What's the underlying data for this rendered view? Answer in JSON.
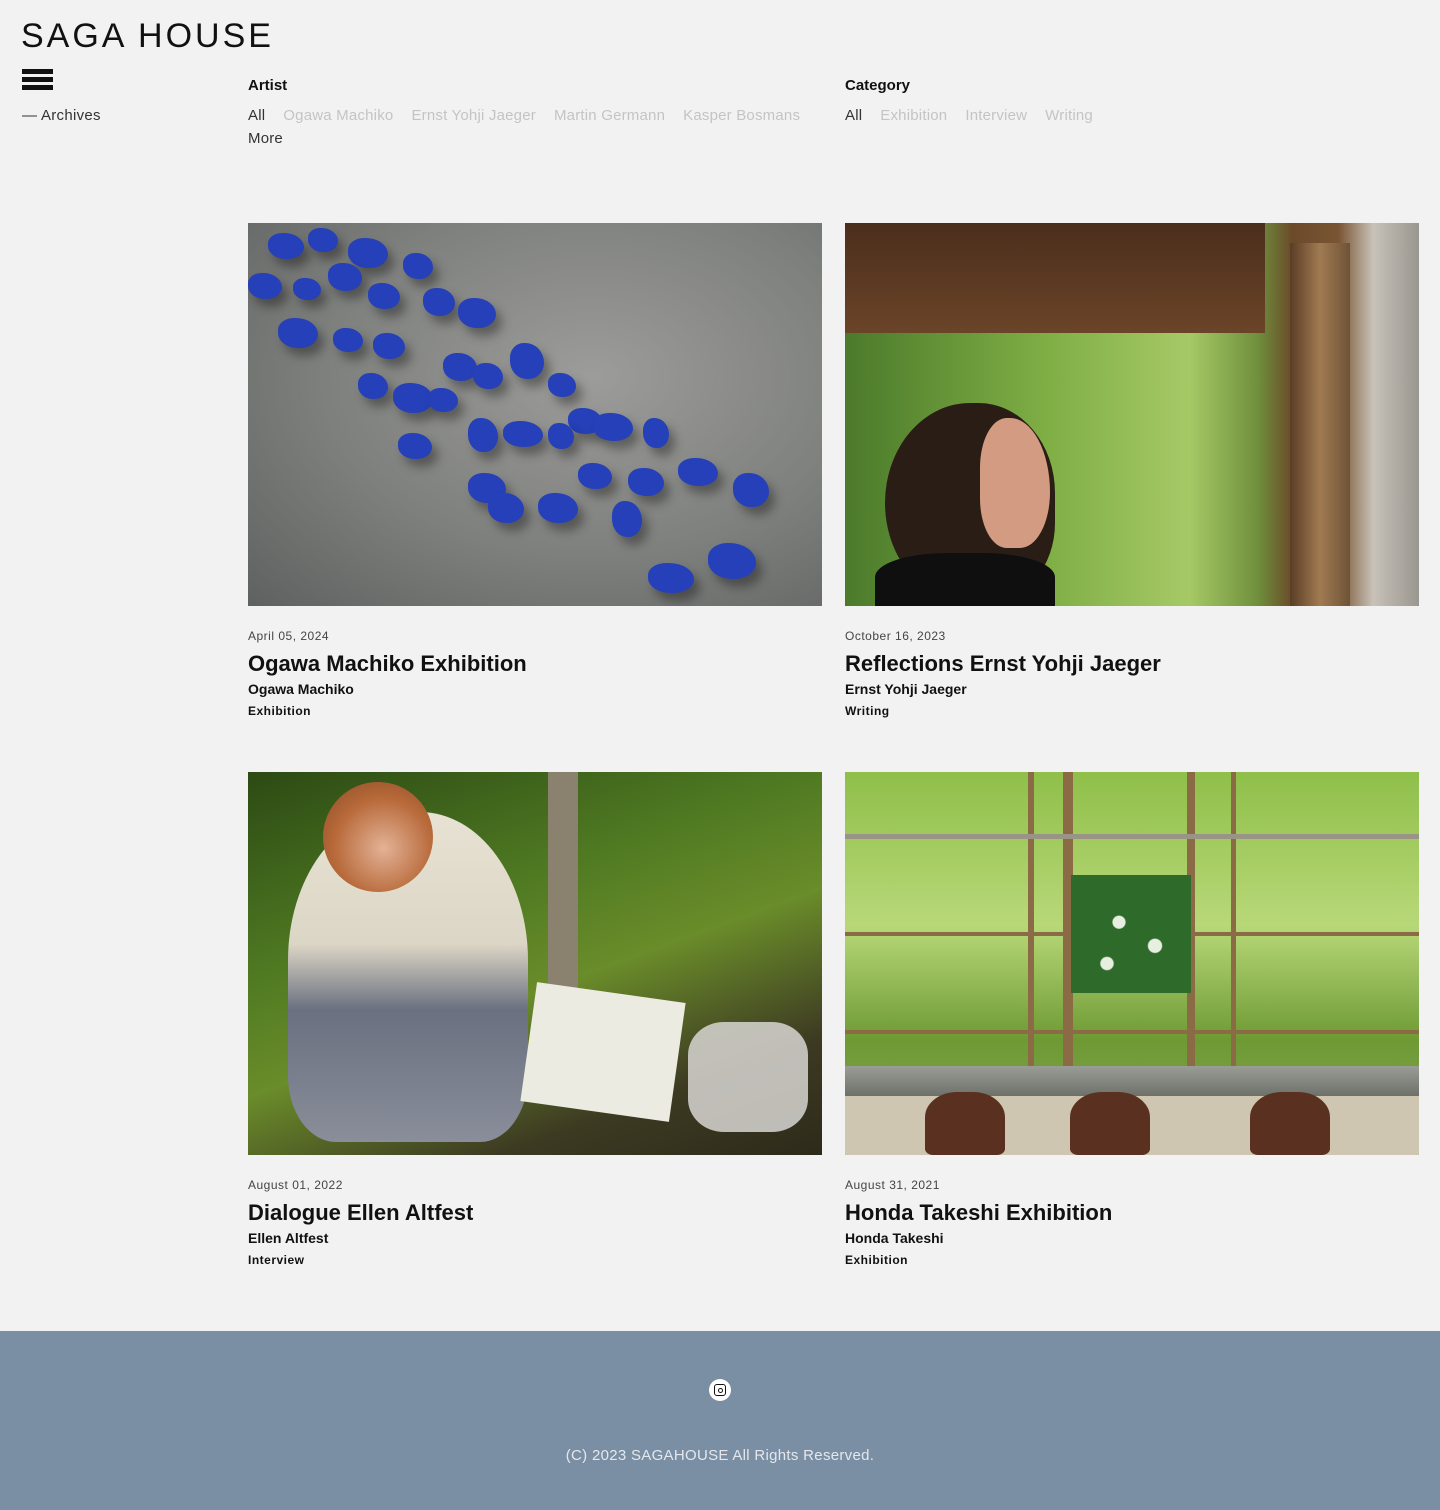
{
  "header": {
    "logo": "SAGA HOUSE",
    "menu_icon": "hamburger-menu-icon",
    "archives_link": "— Archives"
  },
  "filters": {
    "artist": {
      "heading": "Artist",
      "options": [
        "All",
        "Ogawa Machiko",
        "Ernst Yohji Jaeger",
        "Martin Germann",
        "Kasper Bosmans",
        "More"
      ],
      "selected": "All"
    },
    "category": {
      "heading": "Category",
      "options": [
        "All",
        "Exhibition",
        "Interview",
        "Writing"
      ],
      "selected": "All"
    }
  },
  "posts": [
    {
      "date": "April 05, 2024",
      "title": "Ogawa Machiko Exhibition",
      "artist": "Ogawa Machiko",
      "category": "Exhibition"
    },
    {
      "date": "October 16, 2023",
      "title": "Reflections Ernst Yohji Jaeger",
      "artist": "Ernst Yohji Jaeger",
      "category": "Writing"
    },
    {
      "date": "August 01, 2022",
      "title": "Dialogue Ellen Altfest",
      "artist": "Ellen Altfest",
      "category": "Interview"
    },
    {
      "date": "August 31, 2021",
      "title": "Honda Takeshi Exhibition",
      "artist": "Honda Takeshi",
      "category": "Exhibition"
    }
  ],
  "footer": {
    "social_icon": "instagram-icon",
    "copyright": "(C) 2023 SAGAHOUSE All Rights Reserved.",
    "background_color": "#7a8ea4"
  }
}
